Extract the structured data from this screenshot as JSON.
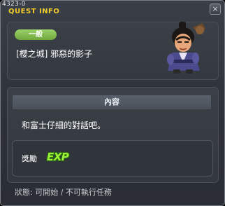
{
  "window": {
    "id_text": "4323-0",
    "title": "QUEST INFO",
    "close_symbol": "×"
  },
  "quest": {
    "category": "一般",
    "name": "[櫻之城] 邪惡的影子"
  },
  "content": {
    "header": "內容",
    "text": "和富士仔細的對話吧。"
  },
  "reward": {
    "label": "獎勵",
    "exp_text": "EXP"
  },
  "status": {
    "text": "狀態:  可開始 / 不可執行任務"
  },
  "icons": [
    "close-icon",
    "npc-avatar"
  ],
  "colors": {
    "title": "#f2ce2d",
    "badge": "#7fb84a",
    "exp": "#9ef23a"
  }
}
